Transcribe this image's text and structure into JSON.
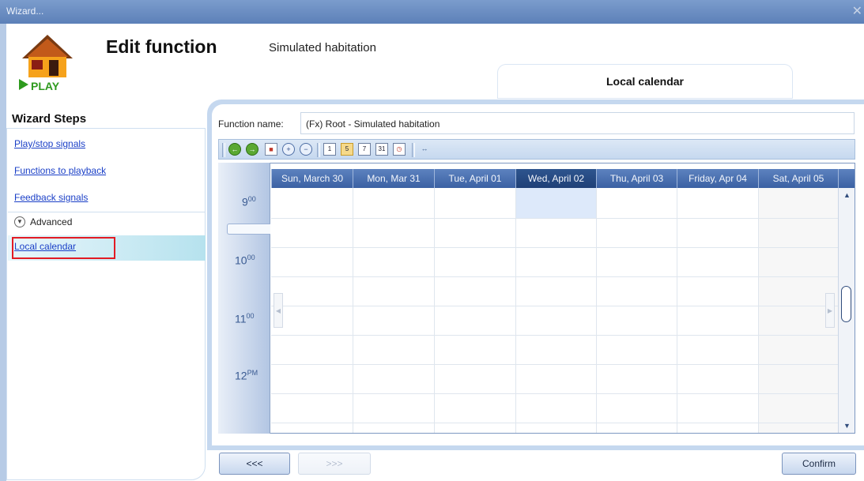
{
  "window": {
    "title": "Wizard...",
    "close_glyph": "✕"
  },
  "header": {
    "title": "Edit function",
    "subtitle": "Simulated habitation",
    "logo_text": "PLAY",
    "logo_icon": "house-play-icon"
  },
  "tab": {
    "label": "Local calendar"
  },
  "sidebar": {
    "title": "Wizard Steps",
    "items": [
      {
        "label": "Play/stop signals"
      },
      {
        "label": "Functions to playback"
      },
      {
        "label": "Feedback signals"
      }
    ],
    "advanced_label": "Advanced",
    "selected_item": "Local calendar"
  },
  "function_name": {
    "label": "Function name:",
    "value": "(Fx) Root - Simulated habitation"
  },
  "toolbar": {
    "buttons": [
      "back-arrow-icon",
      "forward-arrow-icon",
      "today-icon",
      "zoom-in-icon",
      "zoom-out-icon",
      "day-view-icon",
      "work-week-view-icon",
      "week-view-icon",
      "month-view-icon",
      "timeline-view-icon",
      "fit-icon"
    ],
    "work_week_number": "5",
    "day_number": "1",
    "week_number": "7",
    "month_number": "31"
  },
  "calendar": {
    "days": [
      "Sun, March 30",
      "Mon, Mar 31",
      "Tue, April 01",
      "Wed, April 02",
      "Thu, April 03",
      "Friday, Apr 04",
      "Sat, April 05"
    ],
    "selected_day": "Wed, April 02",
    "hours": [
      {
        "num": "9",
        "sup": "00"
      },
      {
        "num": "10",
        "sup": "00"
      },
      {
        "num": "11",
        "sup": "00"
      },
      {
        "num": "12",
        "sup": "PM"
      }
    ],
    "colors": {
      "header": "#4a70b1",
      "highlight": "#dde9fa"
    }
  },
  "buttons": {
    "back": "<<<",
    "next": ">>>",
    "confirm": "Confirm"
  }
}
